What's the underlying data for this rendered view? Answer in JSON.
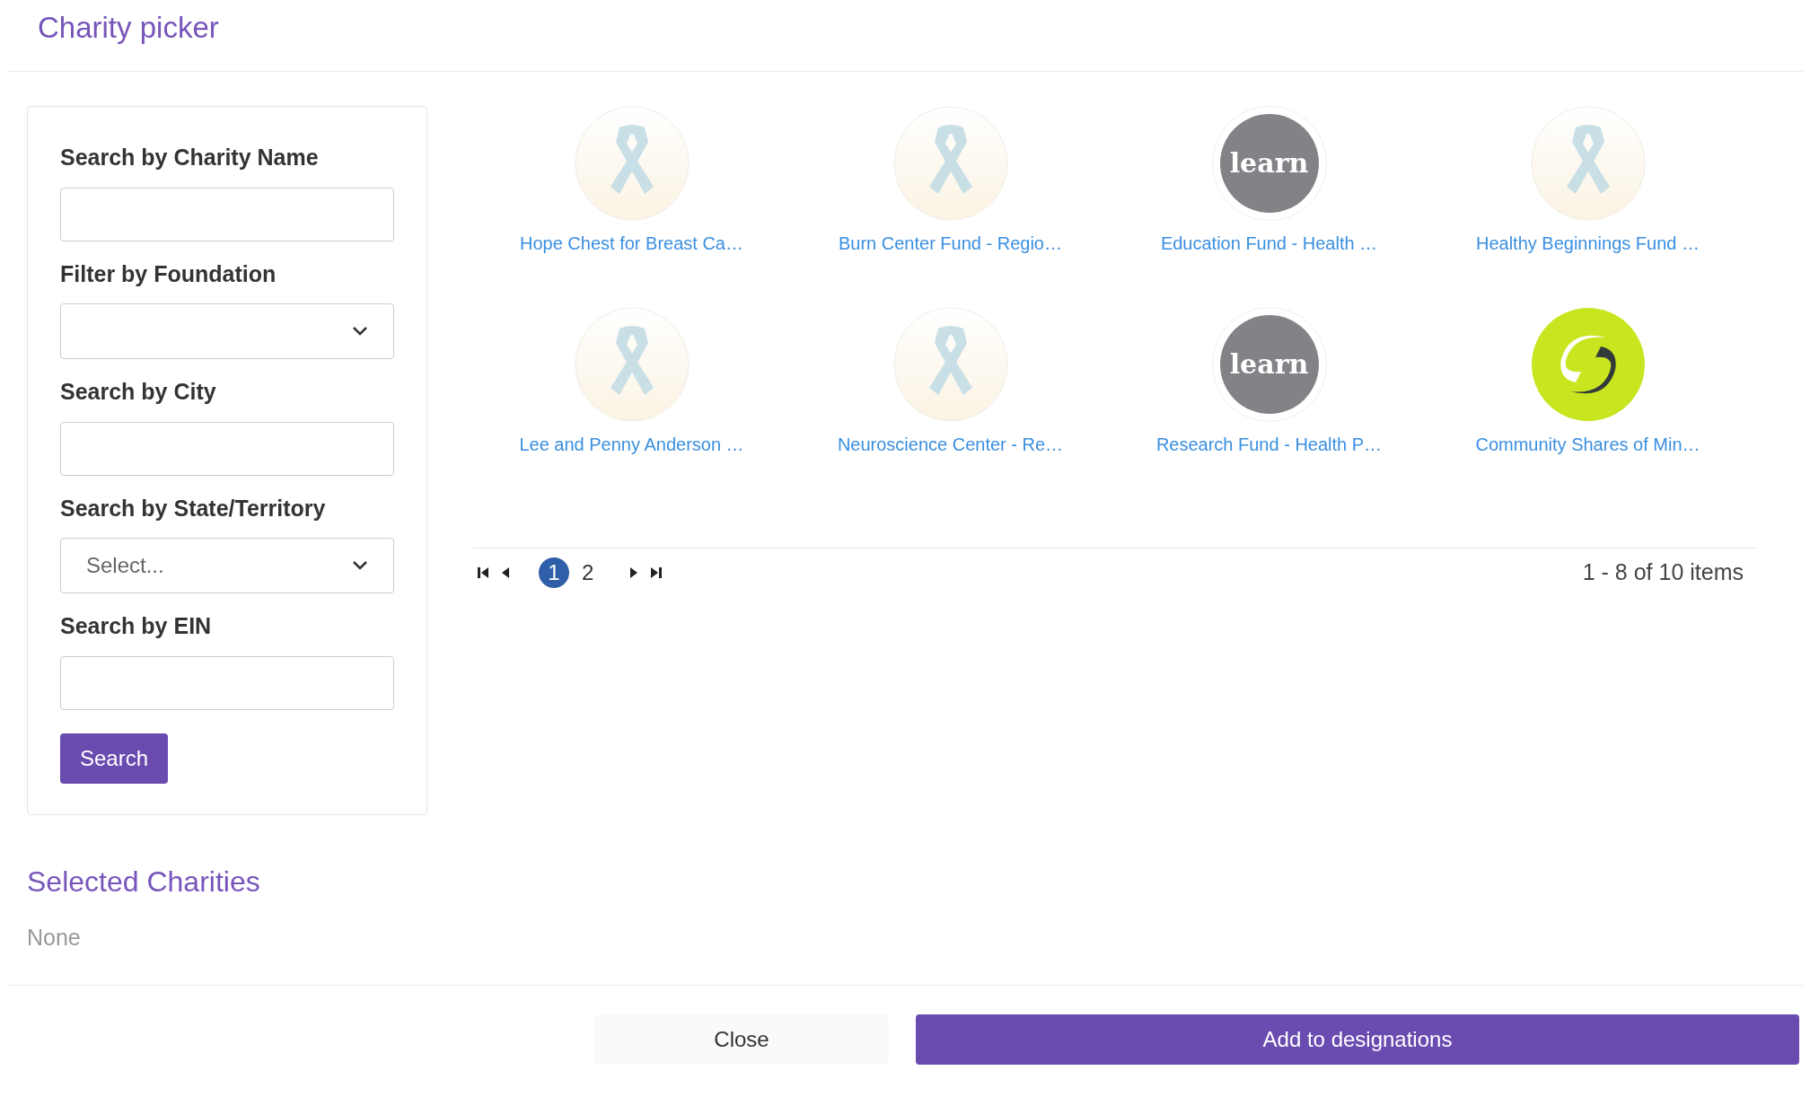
{
  "title": "Charity picker",
  "filters": [
    {
      "kind": "text",
      "label": "Search by Charity Name"
    },
    {
      "kind": "select",
      "label": "Filter by Foundation"
    },
    {
      "kind": "text",
      "label": "Search by City"
    },
    {
      "kind": "select",
      "label": "Search by State/Territory",
      "value": "Select..."
    },
    {
      "kind": "text",
      "label": "Search by EIN"
    }
  ],
  "search_button": "Search",
  "charities": [
    {
      "kind": "ribbon",
      "name": "Hope Chest for Breast Ca…"
    },
    {
      "kind": "ribbon",
      "name": "Burn Center Fund - Regio…"
    },
    {
      "kind": "learn",
      "logo_text": "learn",
      "name": "Education Fund - Health …"
    },
    {
      "kind": "ribbon",
      "name": "Healthy Beginnings Fund …"
    },
    {
      "kind": "ribbon",
      "name": "Lee and Penny Anderson …"
    },
    {
      "kind": "ribbon",
      "name": "Neuroscience Center - Re…"
    },
    {
      "kind": "learn",
      "logo_text": "learn",
      "name": "Research Fund - Health P…"
    },
    {
      "kind": "swirl",
      "name": "Community Shares of Min…"
    }
  ],
  "pagination": {
    "pages": [
      {
        "label": "1",
        "selected": true
      },
      {
        "label": "2",
        "selected": false
      }
    ],
    "summary": "1 - 8 of 10 items"
  },
  "selected_charities": {
    "title": "Selected Charities",
    "empty_text": "None"
  },
  "buttons": {
    "close": "Close",
    "add": "Add to designations"
  }
}
